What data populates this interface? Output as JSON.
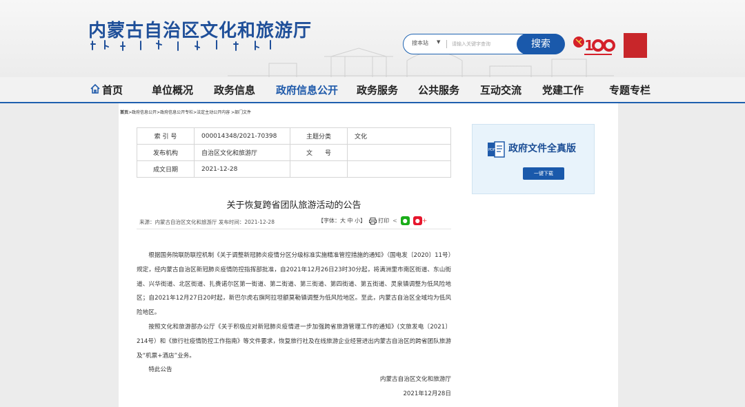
{
  "header": {
    "site_title": "内蒙古自治区文化和旅游厅",
    "search": {
      "scope": "搜本站",
      "placeholder": "请输入关键字查询",
      "button": "搜索"
    },
    "brand_color": "#1f4f99",
    "party_logo_icon": "party-centenary-100-icon",
    "seal_text": "内蒙古",
    "seal_color": "#c8262a"
  },
  "nav": {
    "items": [
      "首页",
      "单位概况",
      "政务信息",
      "政府信息公开",
      "政务服务",
      "公共服务",
      "互动交流",
      "党建工作",
      "专题专栏"
    ],
    "active": "政府信息公开"
  },
  "breadcrumb": {
    "home": "首页",
    "trail": ">政府信息公开>政府信息公开专栏>法定主动公开内容 >部门文件"
  },
  "meta": {
    "index_label": "索 引 号",
    "index_value": "000014348/2021-70398",
    "topic_label": "主题分类",
    "topic_value": "文化",
    "publisher_label": "发布机构",
    "publisher_value": "自治区文化和旅游厅",
    "docno_label": "文　　号",
    "docno_value": "",
    "date_label": "成文日期",
    "date_value": "2021-12-28"
  },
  "sidebar": {
    "title": "政府文件全真版",
    "download": "一键下载",
    "icon": "pdf-document-icon"
  },
  "article": {
    "title": "关于恢复跨省团队旅游活动的公告",
    "info": "来源：内蒙古自治区文化和旅游厅  发布时间：2021-12-28",
    "font_size": "【字体：大 中 小】",
    "print": "打印",
    "paragraphs": [
      "根据国务院联防联控机制《关于调整新冠肺炎疫情分区分级标准实施精准管控措施的通知》（国电发〔2020〕11号）规定，经内蒙古自治区新冠肺炎疫情防控指挥部批准，自2021年12月26日23时30分起，将满洲里市南区街道、东山街道、兴华街道、北区街道、扎赉诺尔区第一街道、第二街道、第三街道、第四街道、第五街道、灵泉镇调整为低风险地区；自2021年12月27日20时起，新巴尔虎右旗阿拉坦额莫勒镇调整为低风险地区。至此，内蒙古自治区全域均为低风险地区。",
      "按照文化和旅游部办公厅《关于积极应对新冠肺炎疫情进一步加强跨省旅游管理工作的通知》(文旅发电〔2021〕214号）和《旅行社疫情防控工作指南》等文件要求，恢复旅行社及在线旅游企业经营进出内蒙古自治区的跨省团队旅游及“机票+酒店”业务。",
      "特此公告"
    ],
    "signer": "内蒙古自治区文化和旅游厅",
    "sign_date": "2021年12月28日"
  }
}
